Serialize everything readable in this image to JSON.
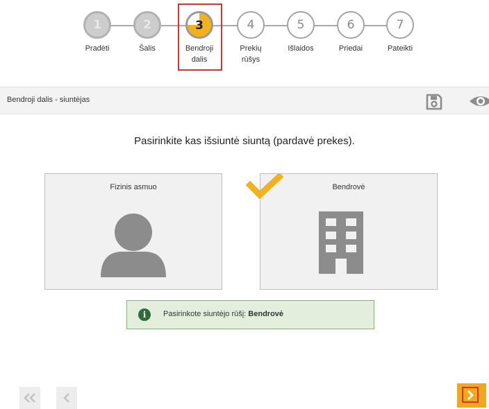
{
  "stepper": {
    "steps": [
      {
        "number": "1",
        "label": "Pradėti",
        "state": "done"
      },
      {
        "number": "2",
        "label": "Šalis",
        "state": "done"
      },
      {
        "number": "3",
        "label": "Bendroji dalis",
        "state": "current"
      },
      {
        "number": "4",
        "label": "Prekių rūšys",
        "state": "todo"
      },
      {
        "number": "5",
        "label": "Išlaidos",
        "state": "todo"
      },
      {
        "number": "6",
        "label": "Priedai",
        "state": "todo"
      },
      {
        "number": "7",
        "label": "Pateikti",
        "state": "todo"
      }
    ],
    "current_progress_fraction": 0.75
  },
  "section": {
    "title": "Bendroji dalis - siuntėjas",
    "icons": [
      "save-icon",
      "eye-icon"
    ]
  },
  "prompt": "Pasirinkite kas išsiuntė siuntą (pardavė prekes).",
  "options": [
    {
      "label": "Fizinis asmuo",
      "icon": "person-icon",
      "selected": false
    },
    {
      "label": "Bendrovė",
      "icon": "building-icon",
      "selected": true
    }
  ],
  "alert": {
    "icon": "info-icon",
    "text": "Pasirinkote siuntėjo rūšį:",
    "value": "Bendrovė"
  },
  "navigation": {
    "icons": [
      "double-chevron-left-icon",
      "chevron-left-icon",
      "chevron-right-icon"
    ]
  },
  "colors": {
    "accent": "#f2b21c",
    "highlight": "#d9312b",
    "alert_bg": "#e4eedd",
    "alert_border": "#8cb27a",
    "icon_gray": "#8c8c8c"
  }
}
